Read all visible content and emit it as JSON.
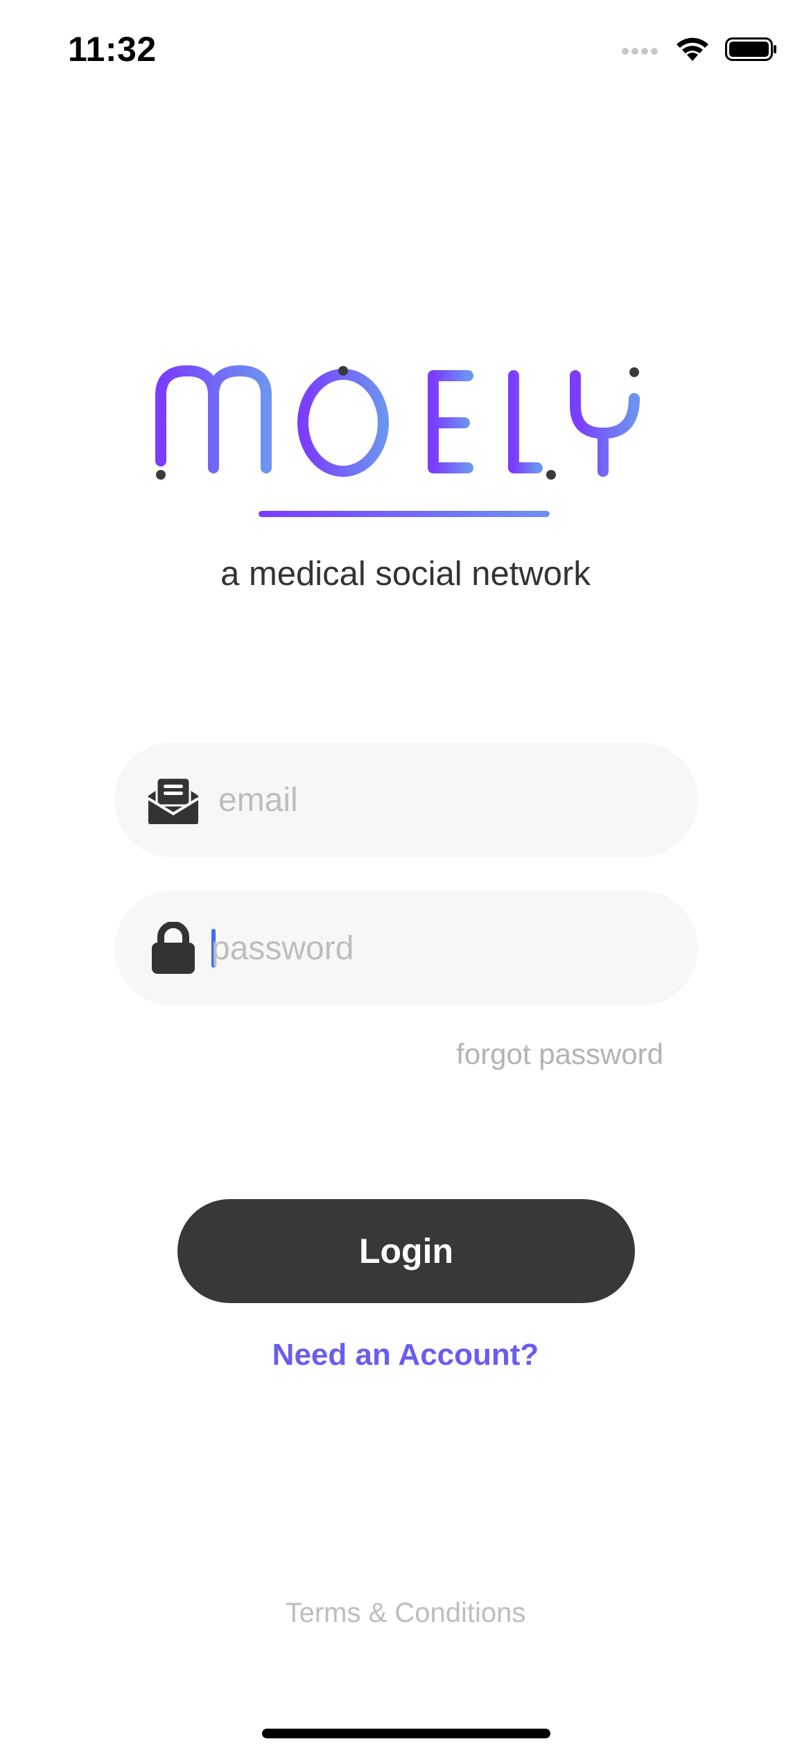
{
  "status_bar": {
    "time": "11:32",
    "icons": [
      "signal-icon",
      "wifi-icon",
      "battery-icon"
    ]
  },
  "brand": {
    "logo_text": "MOELY",
    "tagline": "a medical social network",
    "colors": {
      "gradient_start": "#7a3cff",
      "gradient_end": "#6c93f0",
      "dots": "#3a3a3a"
    }
  },
  "form": {
    "email": {
      "placeholder": "email",
      "value": "",
      "icon": "envelope-open-icon"
    },
    "password": {
      "placeholder": "password",
      "value": "",
      "icon": "lock-icon"
    },
    "forgot_label": "forgot password"
  },
  "actions": {
    "login_label": "Login",
    "signup_label": "Need an Account?",
    "accent_color": "#6a5cf0",
    "button_color": "#383838"
  },
  "footer": {
    "terms_label": "Terms & Conditions"
  }
}
